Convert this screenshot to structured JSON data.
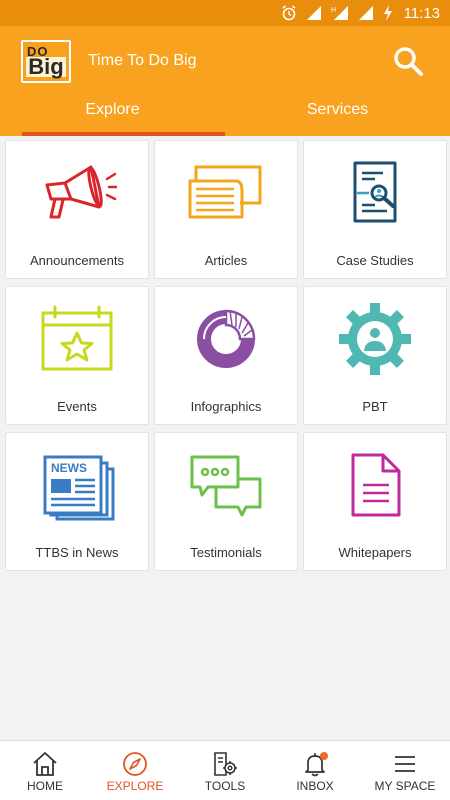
{
  "status_bar": {
    "time": "11:13"
  },
  "app": {
    "logo_line1": "DO",
    "logo_line2": "Big",
    "title": "Time To Do Big"
  },
  "tabs": [
    {
      "label": "Explore",
      "active": true
    },
    {
      "label": "Services",
      "active": false
    }
  ],
  "tiles": [
    {
      "label": "Announcements",
      "icon": "megaphone-icon"
    },
    {
      "label": "Articles",
      "icon": "articles-icon"
    },
    {
      "label": "Case Studies",
      "icon": "case-study-icon"
    },
    {
      "label": "Events",
      "icon": "calendar-star-icon"
    },
    {
      "label": "Infographics",
      "icon": "donut-chart-icon"
    },
    {
      "label": "PBT",
      "icon": "gear-person-icon"
    },
    {
      "label": "TTBS in News",
      "icon": "newspaper-icon"
    },
    {
      "label": "Testimonials",
      "icon": "chat-bubbles-icon"
    },
    {
      "label": "Whitepapers",
      "icon": "document-icon"
    }
  ],
  "news_icon_text": "NEWS",
  "bottom_nav": [
    {
      "label": "HOME",
      "icon": "home-icon"
    },
    {
      "label": "EXPLORE",
      "icon": "compass-icon",
      "active": true
    },
    {
      "label": "TOOLS",
      "icon": "tools-icon"
    },
    {
      "label": "INBOX",
      "icon": "bell-icon",
      "badge": true
    },
    {
      "label": "MY SPACE",
      "icon": "menu-icon"
    }
  ],
  "colors": {
    "status_bar": "#e88e0c",
    "app_bar": "#f9a220",
    "tab_indicator": "#e2551d",
    "active_nav": "#e2551d"
  }
}
